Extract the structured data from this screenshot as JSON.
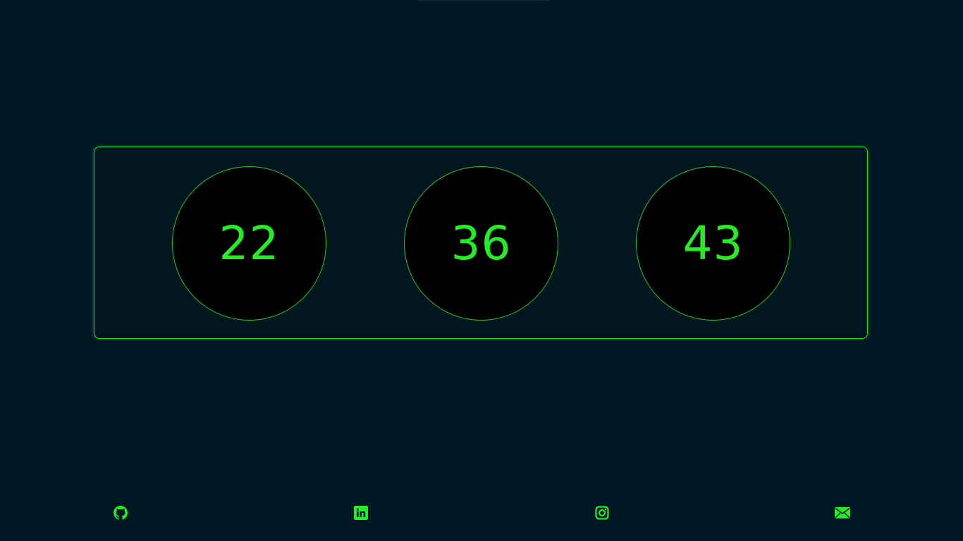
{
  "counters": [
    {
      "value": "22"
    },
    {
      "value": "36"
    },
    {
      "value": "43"
    }
  ],
  "footer": {
    "links": [
      {
        "icon": "github-icon"
      },
      {
        "icon": "linkedin-icon"
      },
      {
        "icon": "instagram-icon"
      },
      {
        "icon": "mail-icon"
      }
    ]
  },
  "colors": {
    "background": "#001826",
    "accent": "#22ee22",
    "circle_fill": "#000000"
  }
}
